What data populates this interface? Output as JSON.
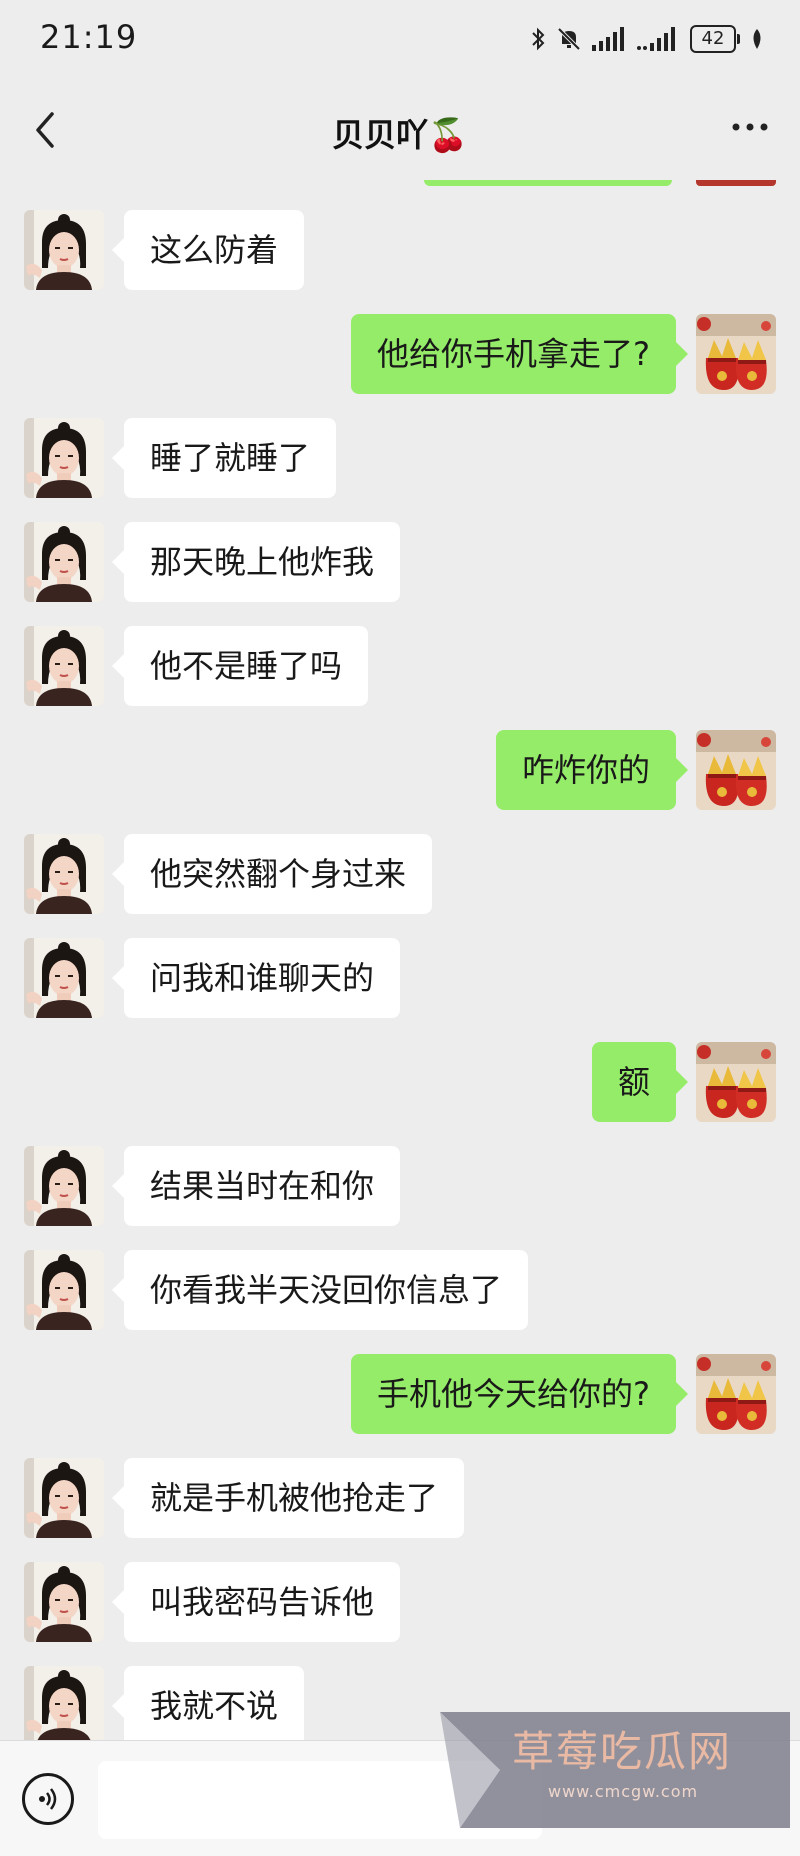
{
  "status_bar": {
    "time": "21:19",
    "battery": "42",
    "icons": [
      "bluetooth-icon",
      "mute-bell-icon",
      "signal-icon",
      "signal-icon",
      "battery-icon",
      "leaf-icon"
    ]
  },
  "nav": {
    "back_icon": "chevron-left-icon",
    "title": "贝贝吖🍒",
    "more_icon": "ellipsis-icon"
  },
  "colors": {
    "background": "#ededed",
    "incoming_bubble": "#ffffff",
    "outgoing_bubble": "#95ec69"
  },
  "messages": [
    {
      "side": "left",
      "text": "这么防着"
    },
    {
      "side": "right",
      "text": "他给你手机拿走了?"
    },
    {
      "side": "left",
      "text": "睡了就睡了"
    },
    {
      "side": "left",
      "text": "那天晚上他炸我"
    },
    {
      "side": "left",
      "text": "他不是睡了吗"
    },
    {
      "side": "right",
      "text": "咋炸你的"
    },
    {
      "side": "left",
      "text": "他突然翻个身过来"
    },
    {
      "side": "left",
      "text": "问我和谁聊天的"
    },
    {
      "side": "right",
      "text": "额"
    },
    {
      "side": "left",
      "text": "结果当时在和你"
    },
    {
      "side": "left",
      "text": "你看我半天没回你信息了"
    },
    {
      "side": "right",
      "text": "手机他今天给你的?"
    },
    {
      "side": "left",
      "text": "就是手机被他抢走了"
    },
    {
      "side": "left",
      "text": "叫我密码告诉他"
    },
    {
      "side": "left",
      "text": "我就不说"
    }
  ],
  "input_bar": {
    "voice_icon": "voice-icon",
    "placeholder": ""
  },
  "watermark": {
    "text": "草莓吃瓜网",
    "url": "www.cmcgw.com"
  }
}
